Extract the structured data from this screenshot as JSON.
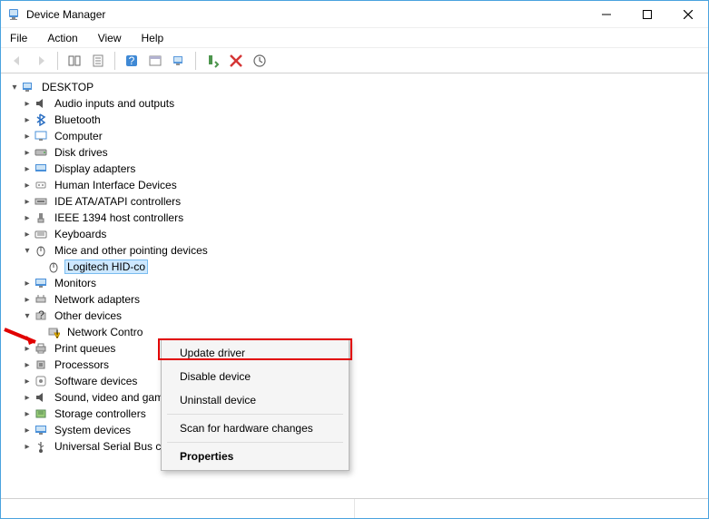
{
  "window": {
    "title": "Device Manager"
  },
  "menu": {
    "file": "File",
    "action": "Action",
    "view": "View",
    "help": "Help"
  },
  "tree": {
    "root": "DESKTOP",
    "nodes": [
      {
        "label": "Audio inputs and outputs"
      },
      {
        "label": "Bluetooth"
      },
      {
        "label": "Computer"
      },
      {
        "label": "Disk drives"
      },
      {
        "label": "Display adapters"
      },
      {
        "label": "Human Interface Devices"
      },
      {
        "label": "IDE ATA/ATAPI controllers"
      },
      {
        "label": "IEEE 1394 host controllers"
      },
      {
        "label": "Keyboards"
      },
      {
        "label": "Mice and other pointing devices"
      }
    ],
    "mouse_child": "Logitech HID-co",
    "after": [
      {
        "label": "Monitors"
      },
      {
        "label": "Network adapters"
      }
    ],
    "other_devices": "Other devices",
    "other_child": "Network Contro",
    "tail": [
      {
        "label": "Print queues"
      },
      {
        "label": "Processors"
      },
      {
        "label": "Software devices"
      },
      {
        "label": "Sound, video and game controllers"
      },
      {
        "label": "Storage controllers"
      },
      {
        "label": "System devices"
      },
      {
        "label": "Universal Serial Bus controllers"
      }
    ]
  },
  "context_menu": {
    "update": "Update driver",
    "disable": "Disable device",
    "uninstall": "Uninstall device",
    "scan": "Scan for hardware changes",
    "properties": "Properties"
  }
}
